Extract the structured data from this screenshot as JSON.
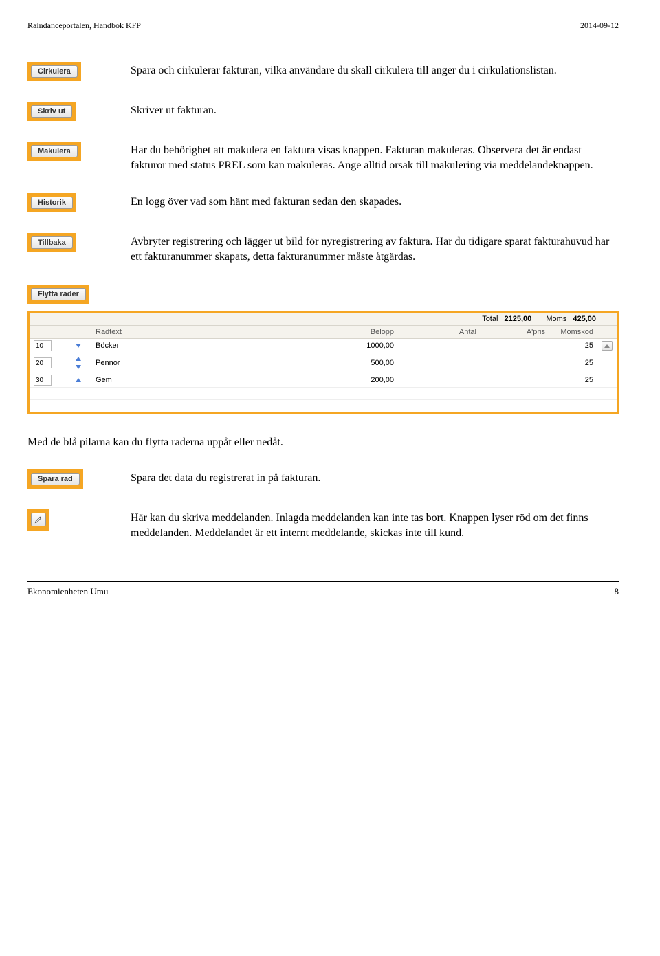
{
  "header": {
    "left": "Raindanceportalen, Handbok KFP",
    "right": "2014-09-12"
  },
  "sections": [
    {
      "button": "Cirkulera",
      "desc": "Spara och cirkulerar fakturan, vilka användare du skall cirkulera till anger du i cirkulationslistan."
    },
    {
      "button": "Skriv ut",
      "desc": "Skriver ut fakturan."
    },
    {
      "button": "Makulera",
      "desc": "Har du behörighet att makulera en faktura visas knappen. Fakturan makuleras. Observera det är endast fakturor med status PREL som kan makuleras. Ange alltid orsak till makulering via meddelandeknappen."
    },
    {
      "button": "Historik",
      "desc": "En logg över vad som hänt med fakturan sedan den skapades."
    },
    {
      "button": "Tillbaka",
      "desc": "Avbryter registrering och lägger ut bild för nyregistrering av faktura. Har du tidigare sparat fakturahuvud har ett fakturanummer skapats, detta fakturanummer måste åtgärdas."
    },
    {
      "button": "Flytta rader",
      "desc": ""
    }
  ],
  "table": {
    "totals": {
      "total_label": "Total",
      "total_value": "2125,00",
      "moms_label": "Moms",
      "moms_value": "425,00"
    },
    "headers": {
      "radtext": "Radtext",
      "belopp": "Belopp",
      "antal": "Antal",
      "apris": "A'pris",
      "momskod": "Momskod"
    },
    "rows": [
      {
        "num": "10",
        "up": false,
        "down": true,
        "radtext": "Böcker",
        "belopp": "1000,00",
        "antal": "",
        "apris": "",
        "moms": "25"
      },
      {
        "num": "20",
        "up": true,
        "down": true,
        "radtext": "Pennor",
        "belopp": "500,00",
        "antal": "",
        "apris": "",
        "moms": "25"
      },
      {
        "num": "30",
        "up": true,
        "down": false,
        "radtext": "Gem",
        "belopp": "200,00",
        "antal": "",
        "apris": "",
        "moms": "25"
      }
    ]
  },
  "body_text_1": "Med de blå pilarna kan du flytta raderna uppåt eller nedåt.",
  "sections2": [
    {
      "button": "Spara rad",
      "icon": null,
      "desc": "Spara det data du registrerat in på fakturan."
    },
    {
      "button": null,
      "icon": "pencil",
      "desc": "Här kan du skriva meddelanden. Inlagda meddelanden kan inte tas bort. Knappen lyser röd om det finns meddelanden. Meddelandet är ett internt meddelande, skickas inte till kund."
    }
  ],
  "footer": {
    "left": "Ekonomienheten Umu",
    "right": "8"
  }
}
